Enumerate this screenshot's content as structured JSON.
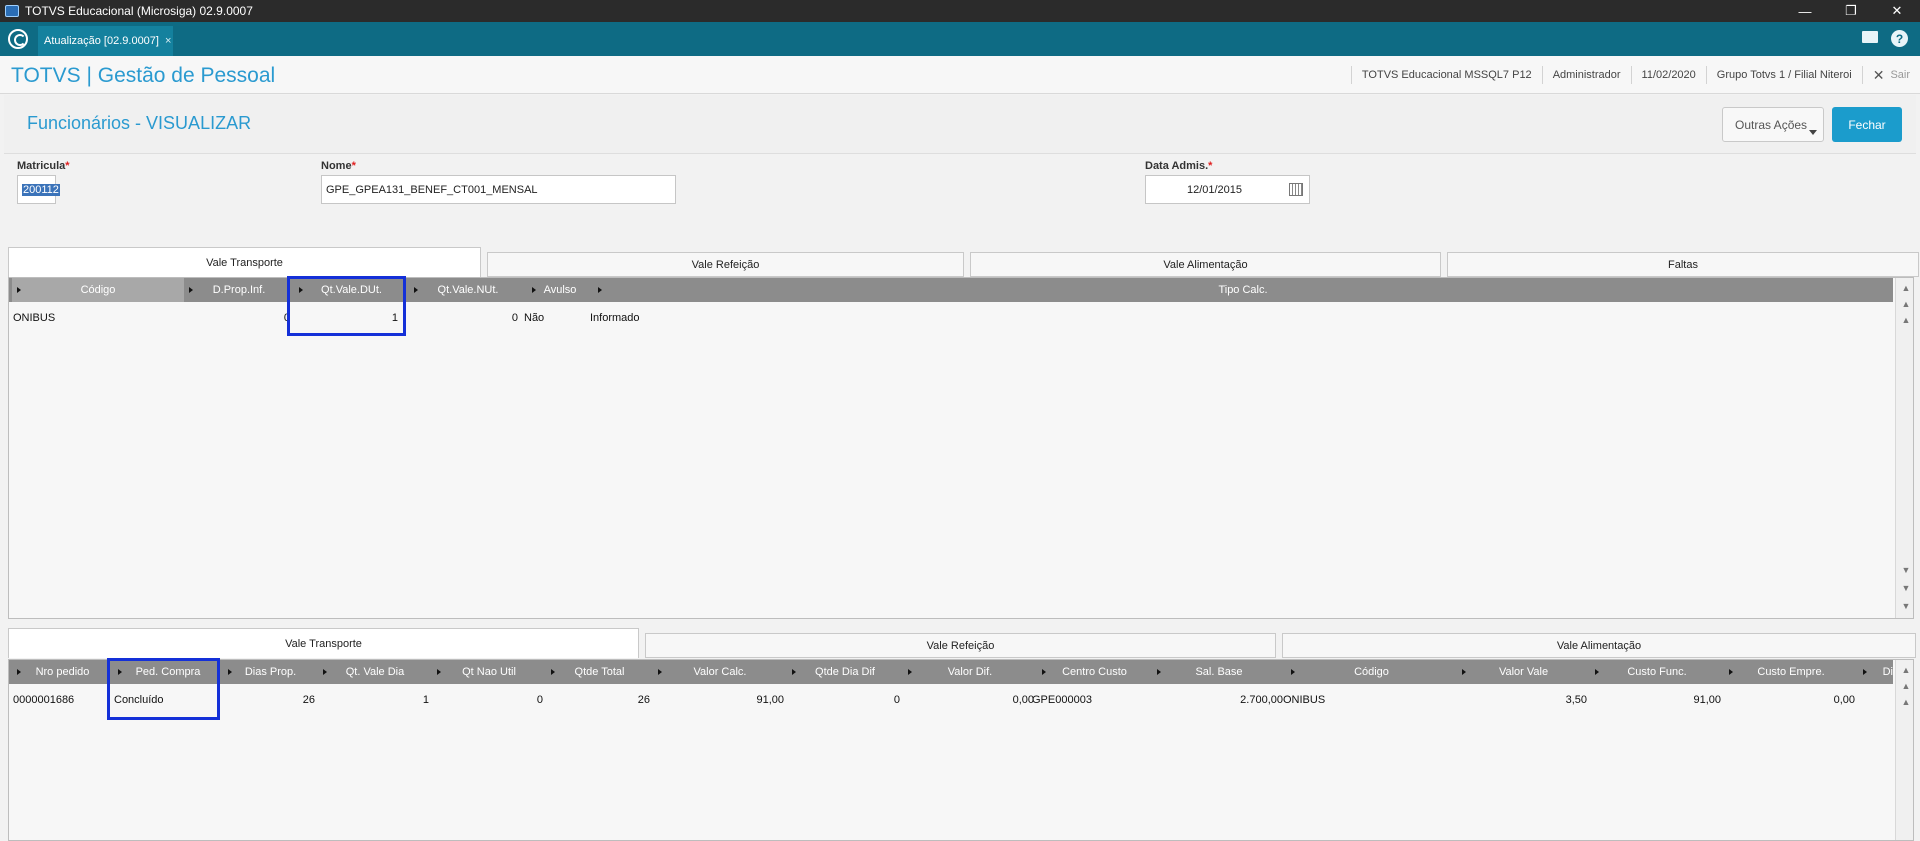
{
  "window": {
    "title": "TOTVS Educacional (Microsiga) 02.9.0007"
  },
  "tabbar": {
    "tab_label": "Atualização [02.9.0007]",
    "tab_close": "×"
  },
  "header": {
    "brand": "TOTVS | Gestão de Pessoal",
    "environment": "TOTVS Educacional MSSQL7 P12",
    "user": "Administrador",
    "date": "11/02/2020",
    "branch": "Grupo Totvs 1 / Filial Niteroi",
    "exit_icon": "✕",
    "exit_label": "Sair"
  },
  "page": {
    "title": "Funcionários - VISUALIZAR",
    "other_actions_label": "Outras Ações",
    "close_label": "Fechar"
  },
  "form": {
    "matricula_label": "Matricula",
    "matricula_value": "200112",
    "nome_label": "Nome",
    "nome_value": "GPE_GPEA131_BENEF_CT001_MENSAL",
    "data_admis_label": "Data Admis.",
    "data_admis_value": "12/01/2015",
    "required_mark": "*"
  },
  "top_tabs": [
    "Vale Transporte",
    "Vale Refeição",
    "Vale Alimentação",
    "Faltas"
  ],
  "top_grid": {
    "columns": [
      "Código",
      "D.Prop.Inf.",
      "Qt.Vale.DUt.",
      "Qt.Vale.NUt.",
      "Avulso",
      "Tipo Calc."
    ],
    "rows": [
      [
        "ONIBUS",
        "0",
        "1",
        "0",
        "Não",
        "Informado"
      ]
    ]
  },
  "bottom_tabs": [
    "Vale Transporte",
    "Vale Refeição",
    "Vale Alimentação"
  ],
  "bottom_grid": {
    "columns": [
      "Nro pedido",
      "Ped. Compra",
      "Dias Prop.",
      "Qt. Vale Dia",
      "Qt Nao Util",
      "Qtde Total",
      "Valor Calc.",
      "Qtde Dia Dif",
      "Valor Dif.",
      "Centro Custo",
      "Sal. Base",
      "Código",
      "Valor Vale",
      "Custo Func.",
      "Custo Empre.",
      "Di"
    ],
    "rows": [
      [
        "0000001686",
        "Concluído",
        "26",
        "1",
        "0",
        "26",
        "91,00",
        "0",
        "0,00",
        "GPE000003",
        "2.700,00",
        "ONIBUS",
        "3,50",
        "91,00",
        "0,00",
        ""
      ]
    ]
  },
  "colors": {
    "accent": "#2a9ad0",
    "tabbar": "#0e6b84",
    "highlight": "#1430d8",
    "primary_button": "#1b9ccc"
  }
}
